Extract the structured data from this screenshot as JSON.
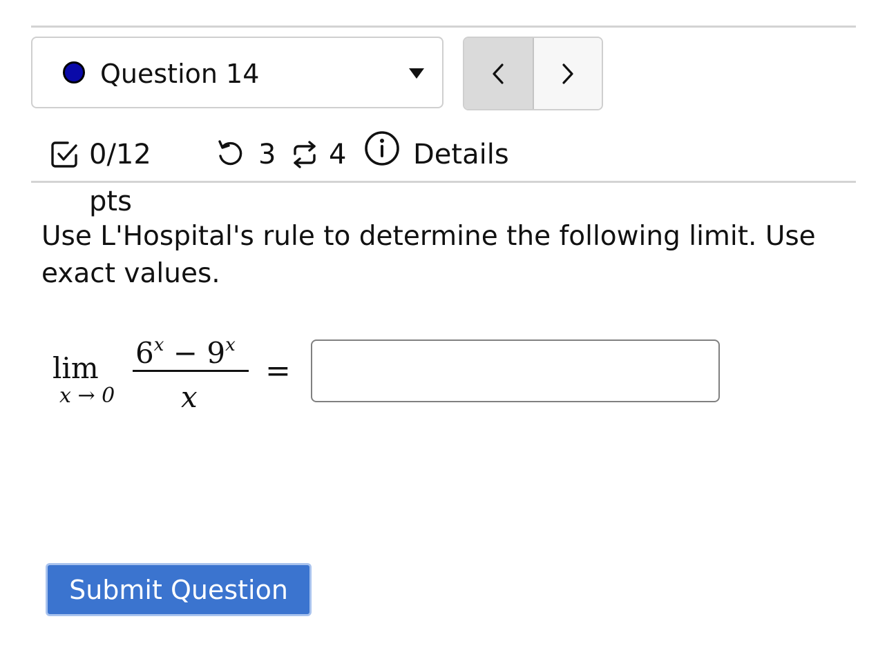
{
  "question_nav": {
    "label": "Question 14",
    "status_color": "#0a0aa8",
    "dropdown_icon": "caret-down-icon",
    "prev_icon": "chevron-left-icon",
    "next_icon": "chevron-right-icon"
  },
  "meta": {
    "score": "0/12 pts",
    "score_icon": "checkbox-icon",
    "retries": "3",
    "retries_icon": "retry-icon",
    "attempts": "4",
    "attempts_icon": "repeat-icon",
    "details_label": "Details",
    "details_icon": "info-icon"
  },
  "question": {
    "prompt": "Use L'Hospital's rule to determine the following limit. Use exact values.",
    "math": {
      "lim": "lim",
      "subscript": "x → 0",
      "num_base1": "6",
      "num_exp1": "x",
      "num_op": "−",
      "num_base2": "9",
      "num_exp2": "x",
      "denominator": "x",
      "equals": "="
    },
    "answer_value": ""
  },
  "submit_label": "Submit Question",
  "colors": {
    "accent": "#3b74cf",
    "rule": "#d3d3d3"
  }
}
